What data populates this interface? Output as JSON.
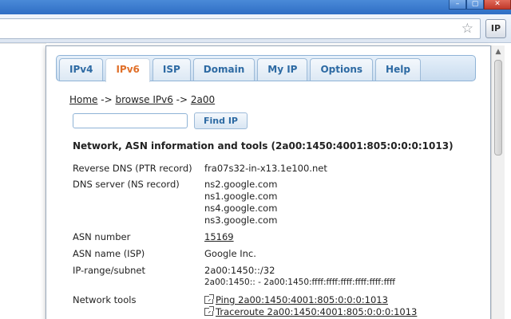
{
  "browser": {
    "extension_button": "IP",
    "window_controls": [
      "–",
      "▢",
      "✕"
    ]
  },
  "popup": {
    "tabs": [
      {
        "label": "IPv4",
        "active": false
      },
      {
        "label": "IPv6",
        "active": true
      },
      {
        "label": "ISP",
        "active": false
      },
      {
        "label": "Domain",
        "active": false
      },
      {
        "label": "My IP",
        "active": false
      },
      {
        "label": "Options",
        "active": false
      },
      {
        "label": "Help",
        "active": false
      }
    ],
    "breadcrumb": {
      "home": "Home",
      "sep1": " -> ",
      "browse": "browse IPv6",
      "sep2": " -> ",
      "current": "2a00"
    },
    "search": {
      "value": "",
      "button": "Find IP"
    },
    "info_title": "Network, ASN information and tools (2a00:1450:4001:805:0:0:0:1013)",
    "rows": {
      "reverse_dns": {
        "label": "Reverse DNS (PTR record)",
        "value": "fra07s32-in-x13.1e100.net"
      },
      "dns_server": {
        "label": "DNS server (NS record)",
        "values": [
          "ns2.google.com",
          "ns1.google.com",
          "ns4.google.com",
          "ns3.google.com"
        ]
      },
      "asn_number": {
        "label": "ASN number",
        "value": "15169"
      },
      "asn_name": {
        "label": "ASN name (ISP)",
        "value": "Google Inc."
      },
      "ip_range": {
        "label": "IP-range/subnet",
        "values": [
          "2a00:1450::/32",
          "2a00:1450:: - 2a00:1450:ffff:ffff:ffff:ffff:ffff:ffff"
        ]
      },
      "network_tools": {
        "label": "Network tools",
        "values": [
          "Ping 2a00:1450:4001:805:0:0:0:1013",
          "Traceroute 2a00:1450:4001:805:0:0:0:1013"
        ]
      }
    }
  }
}
